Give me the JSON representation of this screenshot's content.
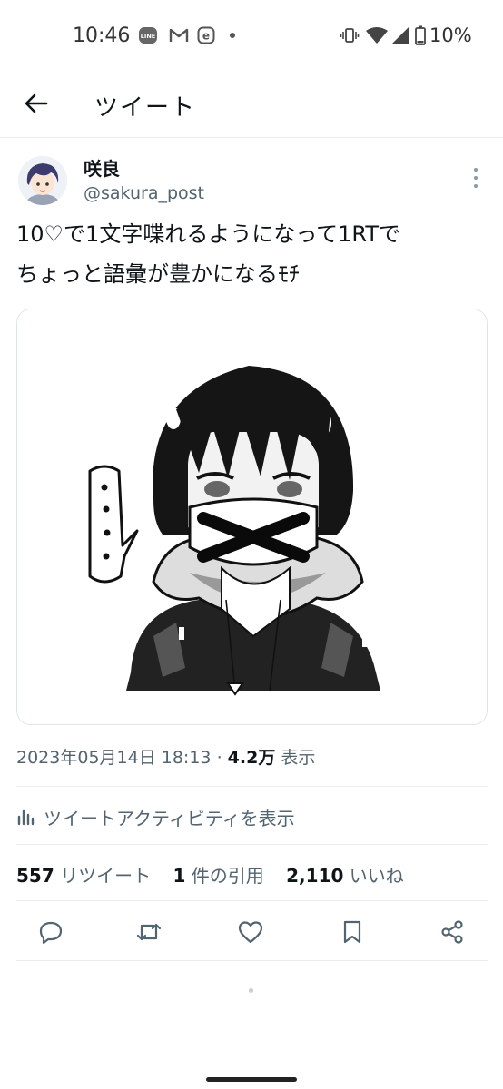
{
  "status_bar": {
    "time": "10:46",
    "notification_icons": [
      "line-icon",
      "gmail-icon",
      "app-e-icon",
      "dot-icon"
    ],
    "system_icons": [
      "vibrate-icon",
      "wifi-icon",
      "signal-icon",
      "battery-icon"
    ],
    "battery": "10%"
  },
  "header": {
    "title": "ツイート"
  },
  "tweet": {
    "display_name": "咲良",
    "handle": "@sakura_post",
    "text_lines": [
      "10♡で1文字喋れるようになって1RTで",
      "ちょっと語彙が豊かになるﾓﾁ"
    ],
    "timestamp": "2023年05月14日 18:13",
    "separator": "·",
    "views_count": "4.2万",
    "views_label": "表示",
    "activity_link": "ツイートアクティビティを表示",
    "retweets_count": "557",
    "retweets_label": "リツイート",
    "quotes_count": "1",
    "quotes_label": "件の引用",
    "likes_count": "2,110",
    "likes_label": "いいね"
  },
  "actions": [
    "reply-icon",
    "retweet-icon",
    "like-icon",
    "bookmark-icon",
    "share-icon"
  ],
  "colors": {
    "text": "#0f1419",
    "secondary": "#536471",
    "divider": "#e6ecf0"
  }
}
